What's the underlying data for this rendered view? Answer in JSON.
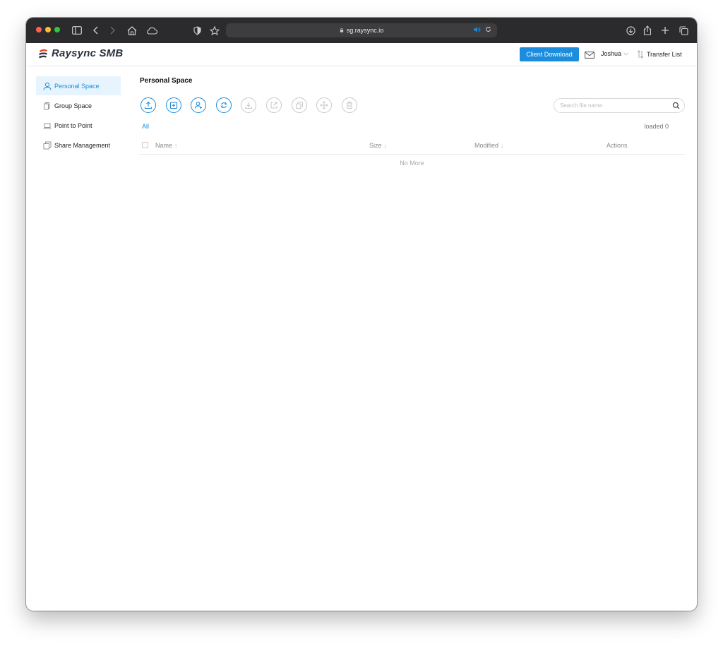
{
  "browser": {
    "url": "sg.raysync.io"
  },
  "app": {
    "brand": "Raysync SMB",
    "client_download": "Client Download",
    "user_name": "Joshua",
    "transfer_list": "Transfer List"
  },
  "sidebar": {
    "items": [
      {
        "label": "Personal Space",
        "icon": "user-icon"
      },
      {
        "label": "Group Space",
        "icon": "group-icon"
      },
      {
        "label": "Point to Point",
        "icon": "laptop-icon"
      },
      {
        "label": "Share Management",
        "icon": "share-icon"
      }
    ]
  },
  "main": {
    "title": "Personal Space",
    "actions": [
      {
        "icon": "upload-icon",
        "enabled": true
      },
      {
        "icon": "new-folder-icon",
        "enabled": true
      },
      {
        "icon": "user-share-icon",
        "enabled": true
      },
      {
        "icon": "refresh-icon",
        "enabled": true
      },
      {
        "icon": "download-icon",
        "enabled": false
      },
      {
        "icon": "external-share-icon",
        "enabled": false
      },
      {
        "icon": "copy-icon",
        "enabled": false
      },
      {
        "icon": "move-icon",
        "enabled": false
      },
      {
        "icon": "delete-icon",
        "enabled": false
      }
    ],
    "search_placeholder": "Search file name",
    "breadcrumb_all": "All",
    "loaded_text": "loaded 0",
    "table": {
      "columns": [
        {
          "label": "Name",
          "sort": "↑"
        },
        {
          "label": "Size",
          "sort": "↓"
        },
        {
          "label": "Modified",
          "sort": "↓"
        },
        {
          "label": "Actions",
          "sort": ""
        }
      ]
    },
    "empty_text": "No More"
  },
  "colors": {
    "accent": "#1b8ddc",
    "disabled": "#c9c9c9",
    "toolbar_bg": "#2b2b2d"
  }
}
